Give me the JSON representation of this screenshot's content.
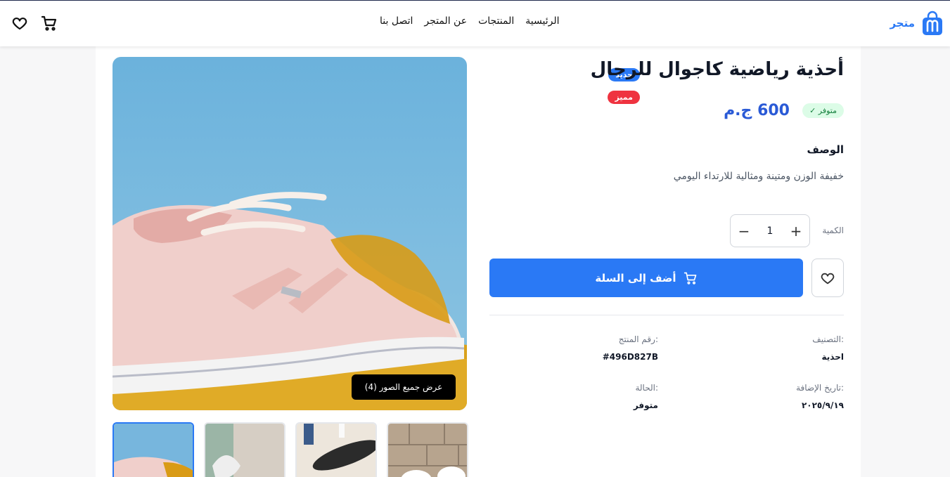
{
  "header": {
    "brand_name": "متجر",
    "nav": [
      "الرئيسية",
      "المنتجات",
      "عن المتجر",
      "اتصل بنا"
    ],
    "icons": [
      "cart-icon",
      "heart-icon"
    ]
  },
  "product": {
    "title": "أحذية رياضية كاجوال للرجال",
    "stock_badge": "متوفر ✓",
    "price": "600 ج.م",
    "badges": {
      "new": "جديد",
      "featured": "مميز"
    },
    "view_all": "عرض جميع الصور (4)",
    "description_heading": "الوصف",
    "description": "خفيفة الوزن ومتينة ومثالية للارتداء اليومي",
    "quantity_label": "الكمية",
    "quantity": "1",
    "add_to_cart": "أضف إلى السلة",
    "meta": {
      "category_label": ":التصنيف",
      "category_value": "احذية",
      "sku_label": ":رقم المنتج",
      "sku_value": "#496D827B",
      "date_label": ":تاريخ الإضافة",
      "date_value": "٢٠٢٥/٩/١٩",
      "status_label": ":الحالة",
      "status_value": "متوفر"
    }
  },
  "colors": {
    "accent": "#2a79f5",
    "price": "#2a5ad6",
    "badge_new": "#2a79f5",
    "badge_featured": "#ef3340",
    "stock_bg": "#dcfce7",
    "stock_text": "#15803d"
  }
}
